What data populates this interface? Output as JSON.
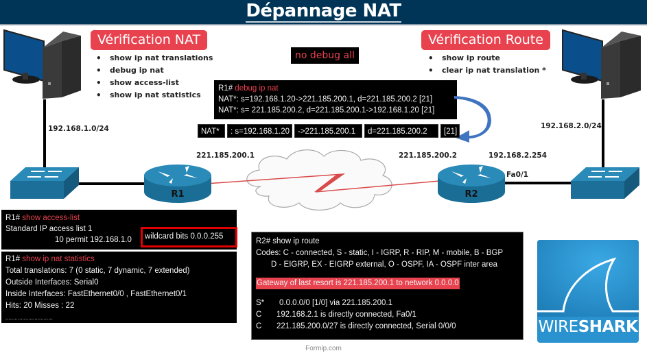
{
  "header": {
    "title": "Dépannage NAT"
  },
  "verification_nat": {
    "title": "Vérification NAT",
    "items": [
      "show ip nat translations",
      "debug ip nat",
      "show access-list",
      "show ip nat statistics"
    ]
  },
  "verification_route": {
    "title": "Vérification Route",
    "items": [
      "show ip route",
      "clear ip nat translation *"
    ]
  },
  "no_debug": {
    "label": "no debug all"
  },
  "debug_terminal": {
    "prompt": "R1# ",
    "command": "debug ip nat",
    "lines": [
      "NAT*: s=192.168.1.20->221.185.200.1, d=221.185.200.2 [21]",
      "NAT*: s= 221.185.200.2, d=221.185.200.1->192.168.1.20 [21]"
    ]
  },
  "nat_breakdown": {
    "cells": [
      "NAT*",
      ": s=192.168.1.20",
      "->221.185.200.1",
      "d=221.185.200.2",
      "[21]"
    ]
  },
  "topology": {
    "left_lan": "192.168.1.0/24",
    "right_lan": "192.168.2.0/24",
    "r1_serial_ip": "221.185.200.1",
    "r2_serial_ip": "221.185.200.2",
    "r2_lan_ip": "192.168.2.254",
    "r2_interface": "Fa0/1",
    "r1_label": "R1",
    "r2_label": "R2"
  },
  "access_list_terminal": {
    "prompt": "R1# ",
    "command": "show access-list",
    "line1": "Standard IP access list 1",
    "line2_prefix": "10 permit 192.168.1.0",
    "line2_highlight": "wildcard bits 0.0.0.255"
  },
  "nat_stats_terminal": {
    "prompt": "R1# ",
    "command": "show ip nat statistics",
    "lines": [
      "Total translations: 7 (0 static, 7 dynamic, 7 extended)",
      "Outside Interfaces: Serial0",
      "Inside Interfaces: FastEthernet0/0 , FastEthernet0/1",
      "Hits: 20   Misses : 22",
      "..............................."
    ]
  },
  "route_terminal": {
    "prompt": "R2# ",
    "command": "show ip route",
    "codes1": "Codes: C - connected, S - static, I - IGRP, R - RIP, M - mobile, B - BGP",
    "codes2": "D - EIGRP, EX - EIGRP external, O - OSPF, IA - OSPF inter area",
    "gateway": "Gateway of last resort is 221.185.200.1 to network 0.0.0.0",
    "routes": [
      {
        "code": "S*",
        "text": "0.0.0.0/0 [1/0] via 221.185.200.1"
      },
      {
        "code": "C",
        "text": "192.168.2.1 is directly connected, Fa0/1"
      },
      {
        "code": "C",
        "text": "221.185.200.0/27 is directly connected, Serial 0/0/0"
      }
    ]
  },
  "wireshark": {
    "word1": "WIRE",
    "word2": "SHARK"
  },
  "footer": {
    "text": "Formip.com"
  },
  "colors": {
    "header_bg": "#003558",
    "accent_red": "#e8424f",
    "device_blue": "#1a6e96",
    "wireshark_blue": "#2a92cf"
  }
}
